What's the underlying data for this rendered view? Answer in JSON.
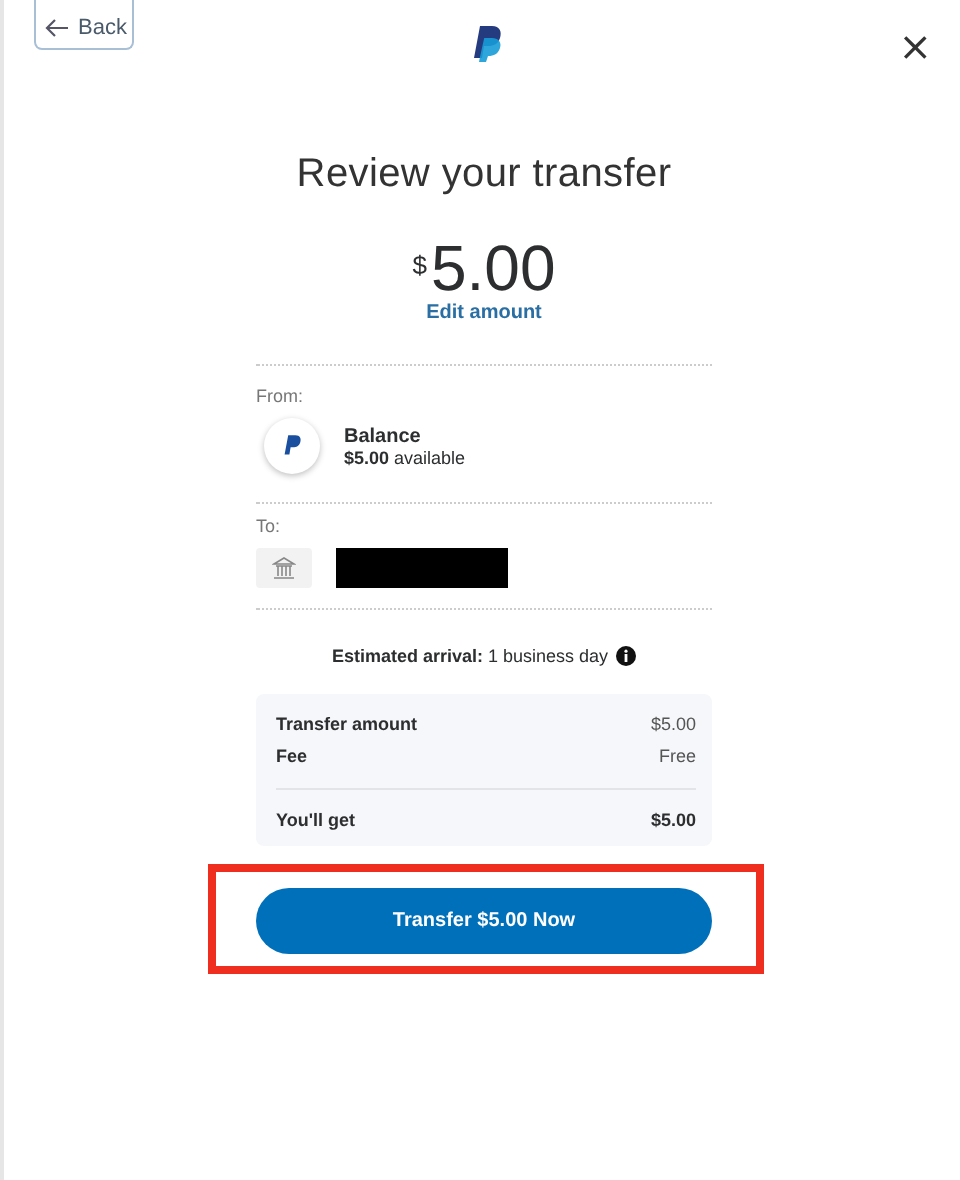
{
  "header": {
    "back": "Back",
    "close": "×"
  },
  "title": "Review your transfer",
  "amount": {
    "currency": "$",
    "value": "5.00",
    "edit": "Edit amount"
  },
  "from": {
    "label": "From:",
    "name": "Balance",
    "detail": "**$5.00** available"
  },
  "to": {
    "label": "To:"
  },
  "arrival": "**Estimated arrival:** 1 business day",
  "summary": {
    "rows": [
      {
        "label": "Transfer amount",
        "value": "$5.00"
      },
      {
        "label": "Fee",
        "value": "Free"
      }
    ],
    "total": {
      "label": "You'll get",
      "value": "$5.00"
    }
  },
  "button": {
    "label": "Transfer $5.00 Now",
    "highlighted": true
  }
}
